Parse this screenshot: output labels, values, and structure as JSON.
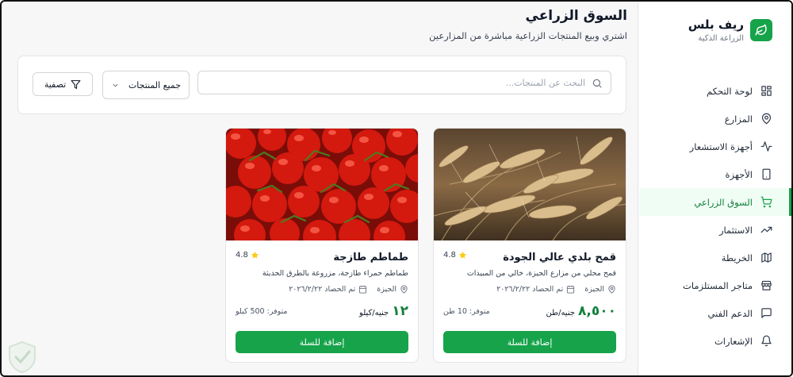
{
  "brand": {
    "name": "ريف بلس",
    "subtitle": "الزراعة الذكية",
    "logo_icon": "leaf-icon",
    "color": "#16a34a"
  },
  "sidebar": {
    "items": [
      {
        "label": "لوحة التحكم",
        "icon": "dashboard-icon"
      },
      {
        "label": "المزارع",
        "icon": "map-pin-icon"
      },
      {
        "label": "أجهزة الاستشعار",
        "icon": "activity-icon"
      },
      {
        "label": "الأجهزة",
        "icon": "device-icon"
      },
      {
        "label": "السوق الزراعي",
        "icon": "cart-icon",
        "active": true
      },
      {
        "label": "الاستثمار",
        "icon": "trending-up-icon"
      },
      {
        "label": "الخريطة",
        "icon": "map-icon"
      },
      {
        "label": "متاجر المستلزمات",
        "icon": "store-icon"
      },
      {
        "label": "الدعم الفني",
        "icon": "message-icon"
      },
      {
        "label": "الإشعارات",
        "icon": "bell-icon"
      }
    ]
  },
  "page": {
    "title": "السوق الزراعي",
    "subtitle": "اشتري وبيع المنتجات الزراعية مباشرة من المزارعين"
  },
  "filters": {
    "search_placeholder": "البحث عن المنتجات...",
    "category_selected": "جميع المنتجات",
    "filter_label": "تصفية"
  },
  "products": [
    {
      "name": "قمح بلدي عالي الجودة",
      "rating": "4.8",
      "description": "قمح محلي من مزارع الجيزة، خالي من المبيدات",
      "location": "الجيزة",
      "harvest": "تم الحصاد ٢٠٢٦/٢/٢٢",
      "price": "٨,٥٠٠",
      "unit": "جنيه/طن",
      "stock": "متوفر: 10 طن",
      "button": "إضافة للسلة",
      "image": "wheat-field"
    },
    {
      "name": "طماطم طازجة",
      "rating": "4.8",
      "description": "طماطم حمراء طازجة، مزروعة بالطرق الحديثة",
      "location": "الجيزة",
      "harvest": "تم الحصاد ٢٠٢٦/٢/٢٢",
      "price": "١٢",
      "unit": "جنيه/كيلو",
      "stock": "متوفر: 500 كيلو",
      "button": "إضافة للسلة",
      "image": "tomatoes"
    }
  ],
  "colors": {
    "accent": "#16a34a",
    "accent_dark": "#15803d",
    "star": "#facc15"
  }
}
